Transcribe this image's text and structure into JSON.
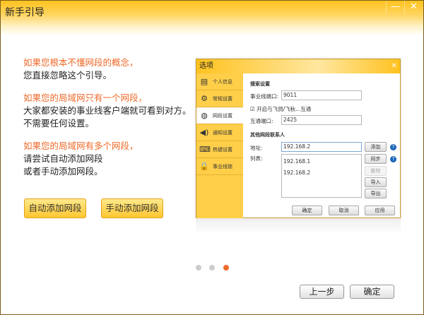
{
  "window": {
    "title": "新手引导",
    "minimize": "—",
    "close": "✕"
  },
  "intro": {
    "p1": {
      "highlight": "如果您根本不懂网段的概念，",
      "text": "您直接忽略这个引导。"
    },
    "p2": {
      "highlight": "如果您的局域网只有一个网段，",
      "text1": "大家都安装的事业线客户端就可看到对方。",
      "text2": "不需要任何设置。"
    },
    "p3": {
      "highlight": "如果您的局域网有多个网段，",
      "text1": "请尝试自动添加网段",
      "text2": "或者手动添加网段。"
    }
  },
  "buttons": {
    "auto_add": "自动添加网段",
    "manual_add": "手动添加网段",
    "prev": "上一步",
    "ok": "确定"
  },
  "pager": {
    "total": 3,
    "current": 3,
    "active_color": "#ef6a2a"
  },
  "options": {
    "title": "选项",
    "close": "✕",
    "sidebar": [
      {
        "label": "个人信息",
        "icon": "id-card-icon"
      },
      {
        "label": "常规设置",
        "icon": "gear-icon"
      },
      {
        "label": "网段设置",
        "icon": "globe-icon",
        "active": true
      },
      {
        "label": "通知设置",
        "icon": "speaker-icon"
      },
      {
        "label": "热键设置",
        "icon": "keyboard-icon"
      },
      {
        "label": "事业线锁",
        "icon": "lock-icon"
      }
    ],
    "search_section": "搜索设置",
    "port_label": "事业线端口:",
    "port_value": "9011",
    "interop_check": "开启与飞鸽/飞秋...互通",
    "interop_checked": true,
    "interop_port_label": "互通端口:",
    "interop_port_value": "2425",
    "contacts_section": "其他网段联系人",
    "address_label": "地址:",
    "address_value": "192.168.2",
    "list_label": "列表:",
    "list_items": [
      "192.168.1",
      "192.168.2"
    ],
    "add": "添加",
    "sync": "同步",
    "delete": "删除",
    "import": "导入",
    "export": "导出",
    "ok": "确定",
    "cancel": "取消",
    "apply": "应用",
    "help": "?"
  }
}
